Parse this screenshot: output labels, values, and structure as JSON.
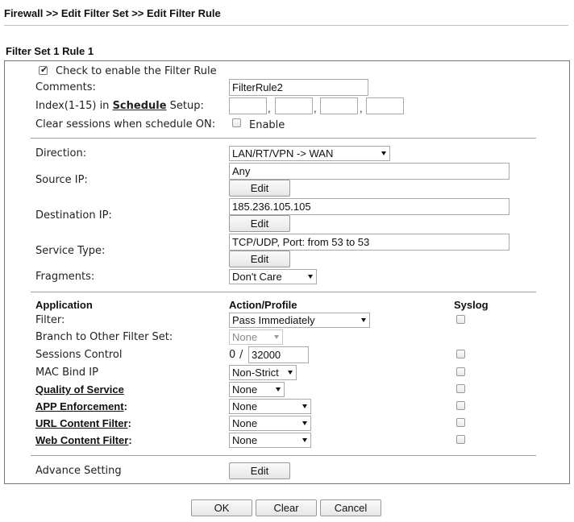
{
  "breadcrumb": "Firewall >> Edit Filter Set >> Edit Filter Rule",
  "section_title": "Filter Set 1 Rule 1",
  "enable_rule": {
    "label": "Check to enable the Filter Rule",
    "checked": true
  },
  "comments": {
    "label": "Comments:",
    "value": "FilterRule2"
  },
  "schedule": {
    "label_prefix": "Index(1-15) in ",
    "link": "Schedule",
    "label_suffix": " Setup:",
    "values": [
      "",
      "",
      "",
      ""
    ],
    "separator": ","
  },
  "clear_sessions": {
    "label": "Clear sessions when schedule ON:",
    "checkbox_label": "Enable",
    "checked": false
  },
  "direction": {
    "label": "Direction:",
    "value": "LAN/RT/VPN -> WAN"
  },
  "source_ip": {
    "label": "Source IP:",
    "value": "Any",
    "button": "Edit"
  },
  "destination_ip": {
    "label": "Destination IP:",
    "value": "185.236.105.105",
    "button": "Edit"
  },
  "service_type": {
    "label": "Service Type:",
    "value": "TCP/UDP, Port: from 53 to 53",
    "button": "Edit"
  },
  "fragments": {
    "label": "Fragments:",
    "value": "Don't Care"
  },
  "table_headers": {
    "application": "Application",
    "action": "Action/Profile",
    "syslog": "Syslog"
  },
  "filter": {
    "label": "Filter:",
    "value": "Pass Immediately"
  },
  "branch": {
    "label": "Branch to Other Filter Set:",
    "value": "None"
  },
  "sessions_control": {
    "label": "Sessions Control",
    "current": "0",
    "separator": "/",
    "max": "32000"
  },
  "mac_bind": {
    "label": "MAC Bind IP",
    "value": "Non-Strict"
  },
  "qos": {
    "label": "Quality of Service",
    "value": "None"
  },
  "app_enforcement": {
    "label": "APP Enforcement",
    "suffix": ":",
    "value": "None"
  },
  "url_filter": {
    "label": "URL Content Filter",
    "suffix": ":",
    "value": "None"
  },
  "web_filter": {
    "label": "Web Content Filter",
    "suffix": ":",
    "value": "None"
  },
  "advance_setting": {
    "label": "Advance Setting",
    "button": "Edit"
  },
  "footer_buttons": {
    "ok": "OK",
    "clear": "Clear",
    "cancel": "Cancel"
  }
}
